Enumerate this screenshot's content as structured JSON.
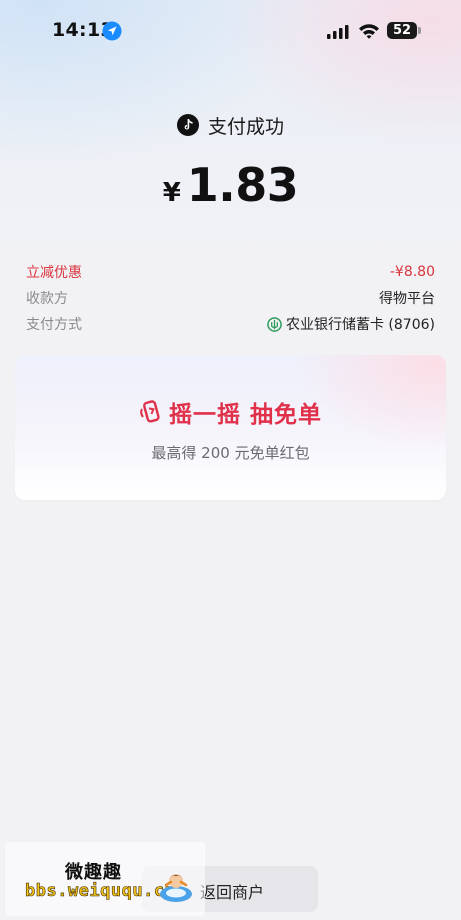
{
  "status_bar": {
    "time": "14:13",
    "battery": "52"
  },
  "header": {
    "title": "支付成功",
    "currency": "¥",
    "amount": "1.83"
  },
  "details": [
    {
      "label": "立减优惠",
      "value": "-¥8.80",
      "highlight": true
    },
    {
      "label": "收款方",
      "value": "得物平台"
    },
    {
      "label": "支付方式",
      "value": "农业银行储蓄卡 (8706)",
      "icon": "bank-icon"
    }
  ],
  "promo": {
    "title": "摇一摇 抽免单",
    "subtitle": "最高得 200 元免单红包",
    "icon": "shake-phone-icon"
  },
  "bottom": {
    "back_label": "返回商户"
  },
  "watermark": {
    "name": "微趣趣",
    "url": "bbs.weiququ.cn"
  },
  "colors": {
    "accent_red": "#d9363e",
    "promo_red": "#e0304a",
    "location_blue": "#1a8cff",
    "bank_green": "#2e9b5b"
  }
}
